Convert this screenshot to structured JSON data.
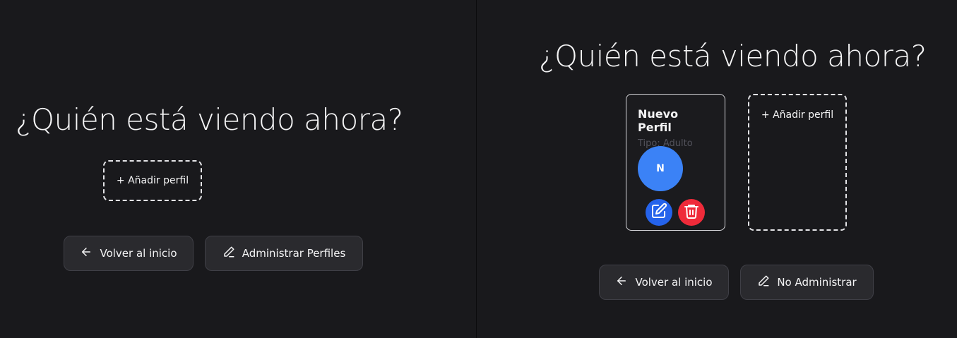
{
  "left": {
    "title": "¿Quién está viendo ahora?",
    "add_profile_label": "+ Añadir perfil",
    "back_button_label": "Volver al inicio",
    "manage_button_label": "Administrar Perfiles"
  },
  "right": {
    "title": "¿Quién está viendo ahora?",
    "profile": {
      "name": "Nuevo Perfil",
      "type": "Tipo: Adulto",
      "avatar_initial": "N"
    },
    "add_profile_label": "+ Añadir perfil",
    "back_button_label": "Volver al inicio",
    "manage_button_label": "No Administrar"
  },
  "icons": {
    "back": "arrow-left-icon",
    "manage": "pencil-icon",
    "edit": "edit-icon",
    "delete": "trash-icon"
  },
  "colors": {
    "background": "#19191c",
    "avatar": "#3b82f6",
    "edit": "#2563eb",
    "delete": "#ef2b3a"
  }
}
